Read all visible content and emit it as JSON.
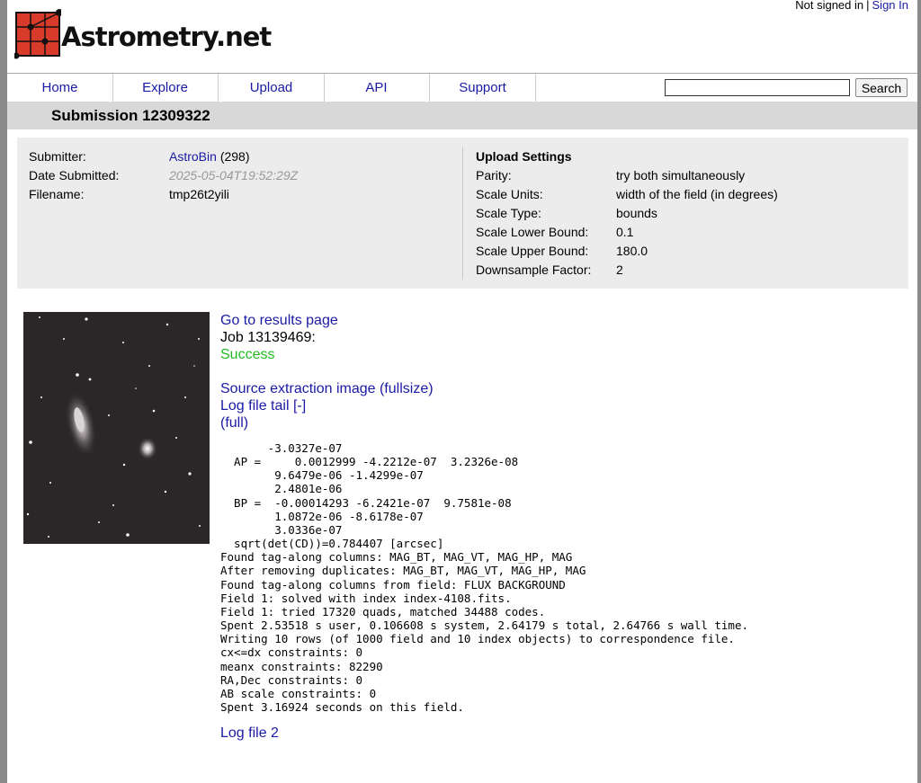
{
  "auth": {
    "status": "Not signed in",
    "separator": "|",
    "sign_in": "Sign In"
  },
  "logo": {
    "text": "Astrometry.net"
  },
  "nav": {
    "tabs": [
      "Home",
      "Explore",
      "Upload",
      "API",
      "Support"
    ],
    "search_button": "Search",
    "search_value": ""
  },
  "title": "Submission 12309322",
  "submission": {
    "submitter_label": "Submitter:",
    "submitter_name": "AstroBin",
    "submitter_count": "(298)",
    "date_label": "Date Submitted:",
    "date_value": "2025-05-04T19:52:29Z",
    "filename_label": "Filename:",
    "filename_value": "tmp26t2yili"
  },
  "upload_settings": {
    "heading": "Upload Settings",
    "rows": [
      {
        "label": "Parity:",
        "value": "try both simultaneously"
      },
      {
        "label": "Scale Units:",
        "value": "width of the field (in degrees)"
      },
      {
        "label": "Scale Type:",
        "value": "bounds"
      },
      {
        "label": "Scale Lower Bound:",
        "value": "0.1"
      },
      {
        "label": "Scale Upper Bound:",
        "value": "180.0"
      },
      {
        "label": "Downsample Factor:",
        "value": "2"
      }
    ]
  },
  "job": {
    "results_link": "Go to results page",
    "job_label": "Job 13139469:",
    "status": "Success",
    "source_link": "Source extraction image (fullsize)",
    "log_tail_link": "Log file tail [-]",
    "full_link": "(full)",
    "log_lines": [
      "       -3.0327e-07",
      "  AP =     0.0012999 -4.2212e-07  3.2326e-08",
      "        9.6479e-06 -1.4299e-07",
      "        2.4801e-06",
      "  BP =  -0.00014293 -6.2421e-07  9.7581e-08",
      "        1.0872e-06 -8.6178e-07",
      "        3.0336e-07",
      "  sqrt(det(CD))=0.784407 [arcsec]",
      "Found tag-along columns: MAG_BT, MAG_VT, MAG_HP, MAG",
      "After removing duplicates: MAG_BT, MAG_VT, MAG_HP, MAG",
      "Found tag-along columns from field: FLUX BACKGROUND",
      "Field 1: solved with index index-4108.fits.",
      "Field 1: tried 17320 quads, matched 34488 codes.",
      "Spent 2.53518 s user, 0.106608 s system, 2.64179 s total, 2.64766 s wall time.",
      "Writing 10 rows (of 1000 field and 10 index objects) to correspondence file.",
      "cx<=dx constraints: 0",
      "meanx constraints: 82290",
      "RA,Dec constraints: 0",
      "AB scale constraints: 0",
      "Spent 3.16924 seconds on this field."
    ],
    "log_file_2": "Log file 2"
  },
  "colors": {
    "link": "#1a1aa6",
    "success": "#22bb22",
    "logo_red": "#d93b2b"
  }
}
